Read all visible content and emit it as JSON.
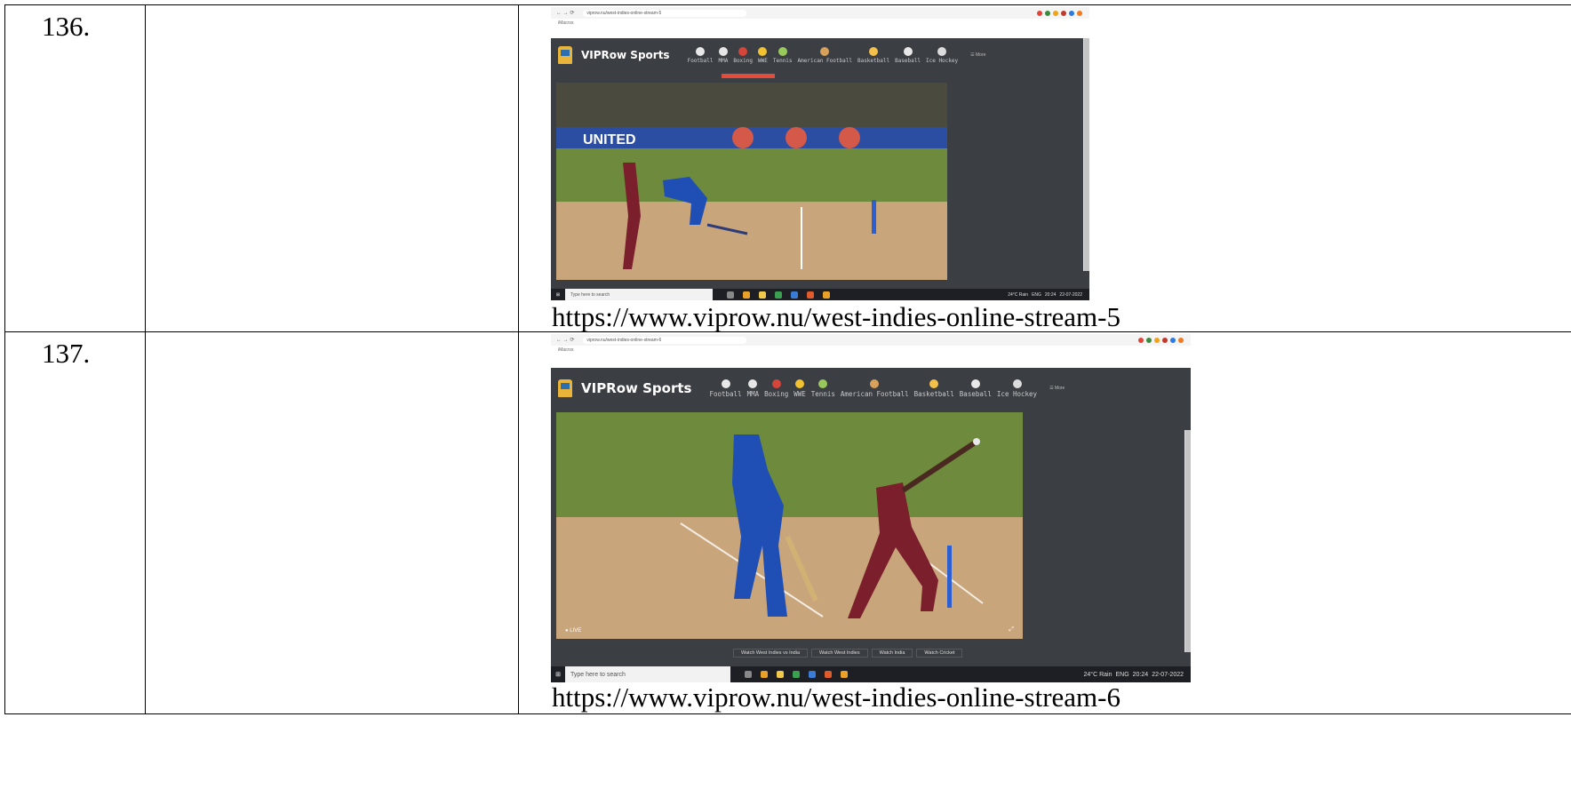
{
  "rows": [
    {
      "number": "136.",
      "url": "https://www.viprow.nu/west-indies-online-stream-5",
      "screenshot": {
        "address": "viprow.nu/west-indies-online-stream-5",
        "bookmark": "iMacros",
        "brand": "VIPRow Sports",
        "nav": [
          "Football",
          "MMA",
          "Boxing",
          "WWE",
          "Tennis",
          "American Football",
          "Basketball",
          "Baseball",
          "Ice Hockey"
        ],
        "more": "☰ More",
        "banner_text": "UNITED",
        "taskbar_search": "Type here to search",
        "weather": "24°C Rain",
        "lang": "ENG",
        "time": "20:24",
        "date": "22-07-2022"
      }
    },
    {
      "number": "137.",
      "url": "https://www.viprow.nu/west-indies-online-stream-6",
      "screenshot": {
        "address": "viprow.nu/west-indies-online-stream-6",
        "bookmark": "iMacros",
        "brand": "VIPRow Sports",
        "nav": [
          "Football",
          "MMA",
          "Boxing",
          "WWE",
          "Tennis",
          "American Football",
          "Basketball",
          "Baseball",
          "Ice Hockey"
        ],
        "more": "☰ More",
        "live": "● LIVE",
        "tabs": [
          "Watch West Indies vs India",
          "Watch West Indies",
          "Watch India",
          "Watch Cricket"
        ],
        "taskbar_search": "Type here to search",
        "weather": "24°C Rain",
        "lang": "ENG",
        "time": "20:24",
        "date": "22-07-2022"
      }
    }
  ],
  "colors": {
    "site_bg": "#3b3e42",
    "pitch": "#c9a57c",
    "outfield": "#6e8a3c",
    "india_blue": "#1f4fb5",
    "wi_maroon": "#7a1f2b"
  }
}
